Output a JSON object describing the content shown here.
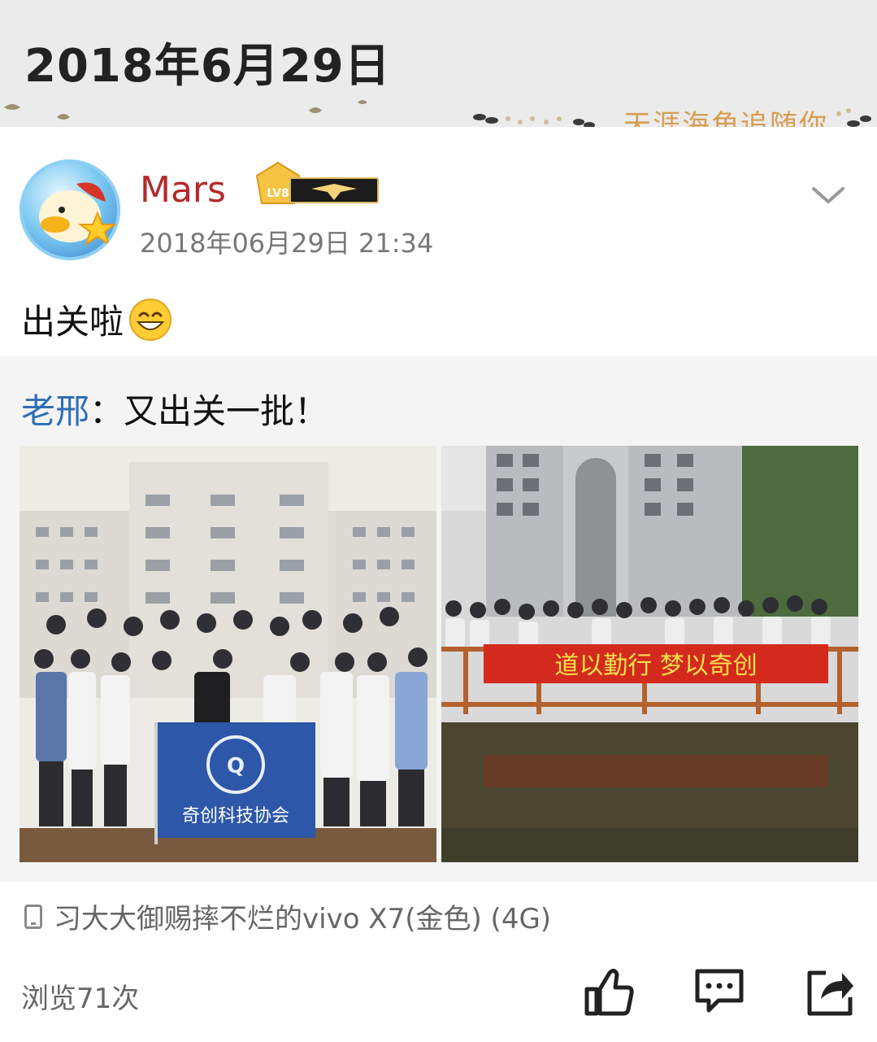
{
  "header": {
    "date": "2018年6月29日",
    "slogan": "天涯海角追随你"
  },
  "post": {
    "username": "Mars",
    "level_badge": "LV8",
    "time": "2018年06月29日 21:34",
    "text": "出关啦",
    "quote": {
      "author": "老邢",
      "separator": "：",
      "text": "又出关一批！"
    },
    "photo2_banner": "道以勤行 梦以奇创",
    "photo1_flag_text": "奇创科技协会",
    "device": "习大大御赐摔不烂的vivo X7(金色) (4G)",
    "views": "浏览71次"
  }
}
